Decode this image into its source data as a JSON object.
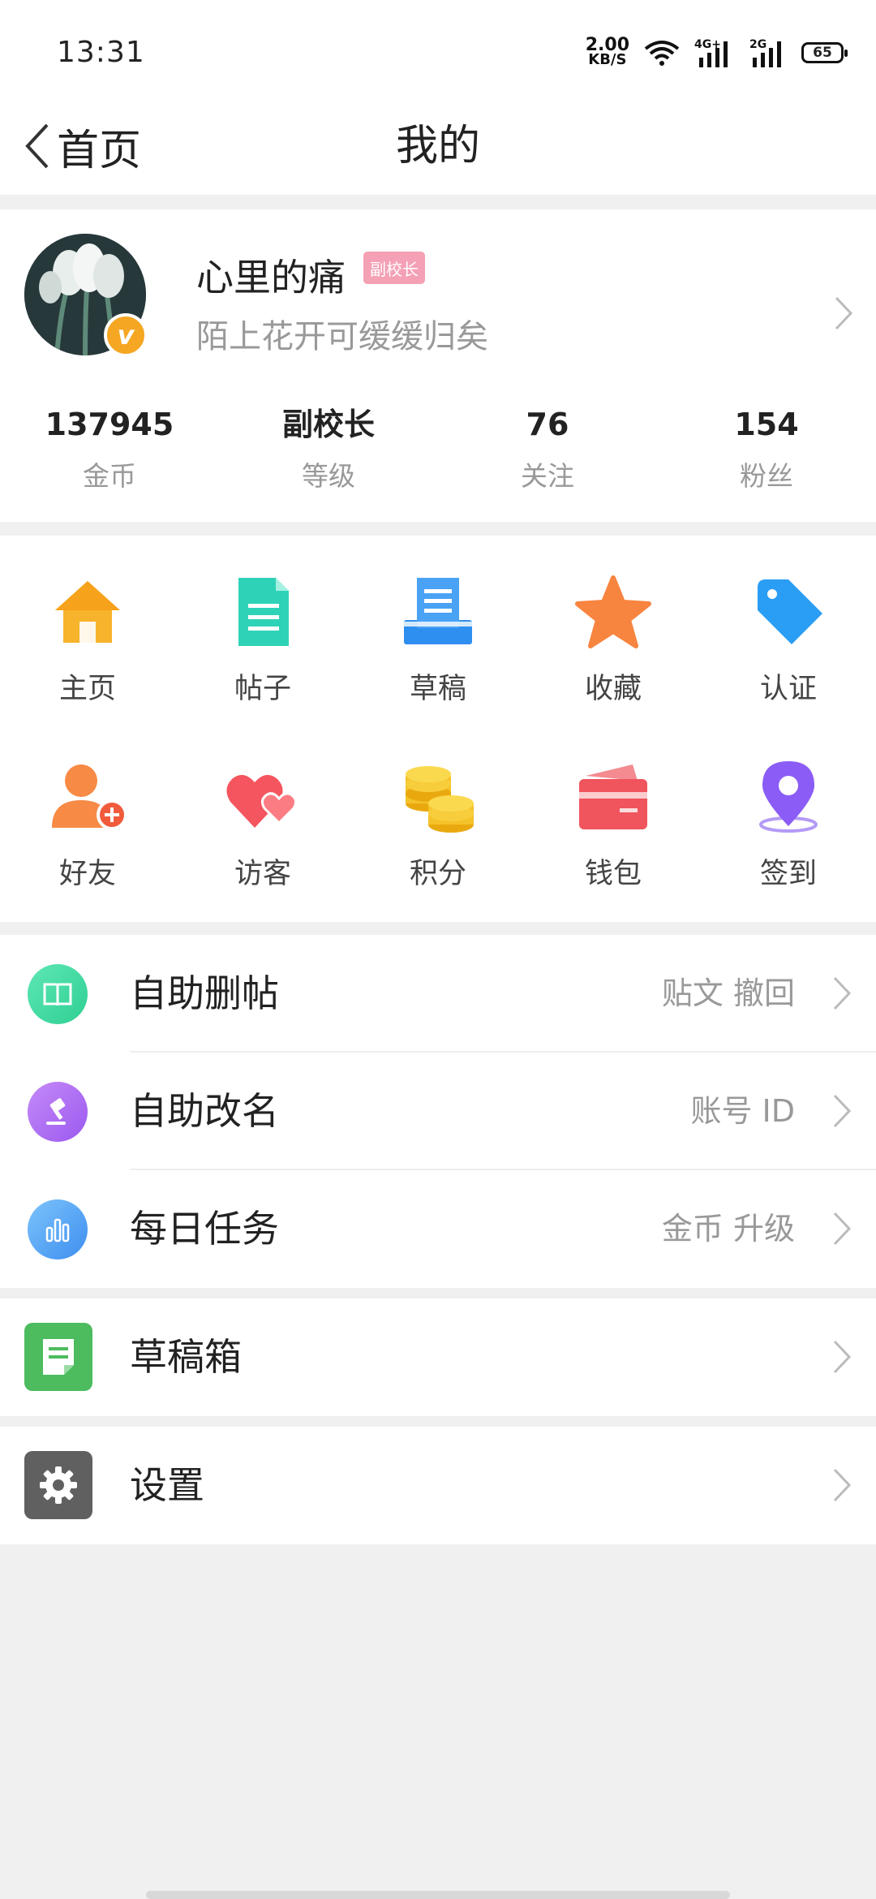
{
  "status_bar": {
    "time": "13:31",
    "net_speed": "2.00",
    "net_unit": "KB/S",
    "battery": "65",
    "signal_1": "4G+",
    "signal_2": "2G"
  },
  "nav": {
    "back_label": "首页",
    "title": "我的"
  },
  "profile": {
    "username": "心里的痛",
    "rank_badge": "副校长",
    "signature": "陌上花开可缓缓归矣",
    "stats": [
      {
        "value": "137945",
        "label": "金币"
      },
      {
        "value": "副校长",
        "label": "等级"
      },
      {
        "value": "76",
        "label": "关注"
      },
      {
        "value": "154",
        "label": "粉丝"
      }
    ]
  },
  "grid": [
    {
      "label": "主页",
      "icon": "house-icon"
    },
    {
      "label": "帖子",
      "icon": "document-icon"
    },
    {
      "label": "草稿",
      "icon": "draft-tray-icon"
    },
    {
      "label": "收藏",
      "icon": "star-icon"
    },
    {
      "label": "认证",
      "icon": "tag-icon"
    },
    {
      "label": "好友",
      "icon": "add-friend-icon"
    },
    {
      "label": "访客",
      "icon": "hearts-icon"
    },
    {
      "label": "积分",
      "icon": "coins-icon"
    },
    {
      "label": "钱包",
      "icon": "wallet-icon"
    },
    {
      "label": "签到",
      "icon": "location-pin-icon"
    }
  ],
  "menu": [
    {
      "label": "自助删帖",
      "extra": "贴文  撤回",
      "icon": "book-icon"
    },
    {
      "label": "自助改名",
      "extra": "账号  ID",
      "icon": "gavel-icon"
    },
    {
      "label": "每日任务",
      "extra": "金币  升级",
      "icon": "bar-chart-icon"
    }
  ],
  "drafts": {
    "label": "草稿箱",
    "icon": "note-icon"
  },
  "settings": {
    "label": "设置",
    "icon": "gear-icon"
  },
  "colors": {
    "accent_orange": "#f5a623",
    "badge_pink": "#f4a0b5",
    "muted_text": "#999999",
    "page_bg": "#f0f0f0"
  }
}
